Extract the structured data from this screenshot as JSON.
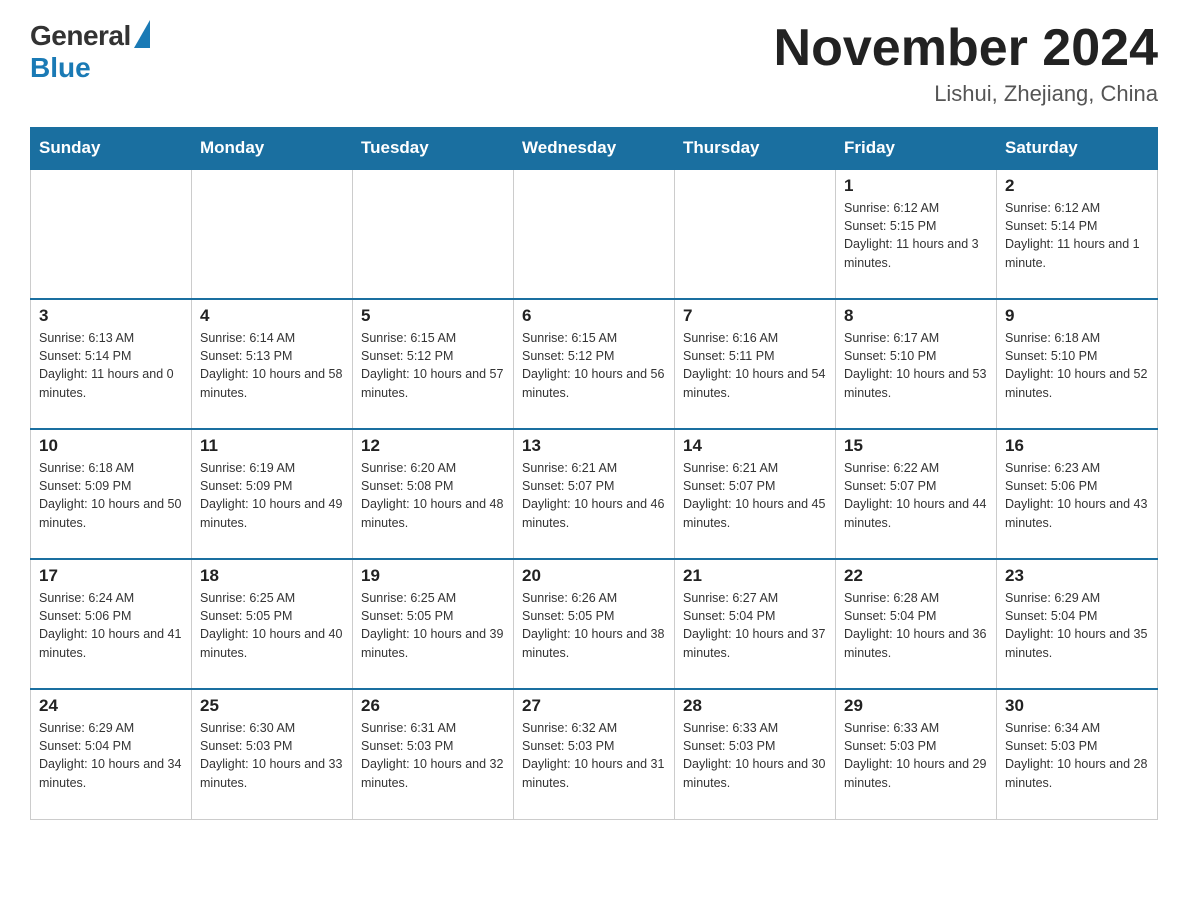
{
  "header": {
    "logo_general": "General",
    "logo_blue": "Blue",
    "month_title": "November 2024",
    "location": "Lishui, Zhejiang, China"
  },
  "days_of_week": [
    "Sunday",
    "Monday",
    "Tuesday",
    "Wednesday",
    "Thursday",
    "Friday",
    "Saturday"
  ],
  "weeks": [
    {
      "days": [
        {
          "number": "",
          "info": ""
        },
        {
          "number": "",
          "info": ""
        },
        {
          "number": "",
          "info": ""
        },
        {
          "number": "",
          "info": ""
        },
        {
          "number": "",
          "info": ""
        },
        {
          "number": "1",
          "info": "Sunrise: 6:12 AM\nSunset: 5:15 PM\nDaylight: 11 hours and 3 minutes."
        },
        {
          "number": "2",
          "info": "Sunrise: 6:12 AM\nSunset: 5:14 PM\nDaylight: 11 hours and 1 minute."
        }
      ]
    },
    {
      "days": [
        {
          "number": "3",
          "info": "Sunrise: 6:13 AM\nSunset: 5:14 PM\nDaylight: 11 hours and 0 minutes."
        },
        {
          "number": "4",
          "info": "Sunrise: 6:14 AM\nSunset: 5:13 PM\nDaylight: 10 hours and 58 minutes."
        },
        {
          "number": "5",
          "info": "Sunrise: 6:15 AM\nSunset: 5:12 PM\nDaylight: 10 hours and 57 minutes."
        },
        {
          "number": "6",
          "info": "Sunrise: 6:15 AM\nSunset: 5:12 PM\nDaylight: 10 hours and 56 minutes."
        },
        {
          "number": "7",
          "info": "Sunrise: 6:16 AM\nSunset: 5:11 PM\nDaylight: 10 hours and 54 minutes."
        },
        {
          "number": "8",
          "info": "Sunrise: 6:17 AM\nSunset: 5:10 PM\nDaylight: 10 hours and 53 minutes."
        },
        {
          "number": "9",
          "info": "Sunrise: 6:18 AM\nSunset: 5:10 PM\nDaylight: 10 hours and 52 minutes."
        }
      ]
    },
    {
      "days": [
        {
          "number": "10",
          "info": "Sunrise: 6:18 AM\nSunset: 5:09 PM\nDaylight: 10 hours and 50 minutes."
        },
        {
          "number": "11",
          "info": "Sunrise: 6:19 AM\nSunset: 5:09 PM\nDaylight: 10 hours and 49 minutes."
        },
        {
          "number": "12",
          "info": "Sunrise: 6:20 AM\nSunset: 5:08 PM\nDaylight: 10 hours and 48 minutes."
        },
        {
          "number": "13",
          "info": "Sunrise: 6:21 AM\nSunset: 5:07 PM\nDaylight: 10 hours and 46 minutes."
        },
        {
          "number": "14",
          "info": "Sunrise: 6:21 AM\nSunset: 5:07 PM\nDaylight: 10 hours and 45 minutes."
        },
        {
          "number": "15",
          "info": "Sunrise: 6:22 AM\nSunset: 5:07 PM\nDaylight: 10 hours and 44 minutes."
        },
        {
          "number": "16",
          "info": "Sunrise: 6:23 AM\nSunset: 5:06 PM\nDaylight: 10 hours and 43 minutes."
        }
      ]
    },
    {
      "days": [
        {
          "number": "17",
          "info": "Sunrise: 6:24 AM\nSunset: 5:06 PM\nDaylight: 10 hours and 41 minutes."
        },
        {
          "number": "18",
          "info": "Sunrise: 6:25 AM\nSunset: 5:05 PM\nDaylight: 10 hours and 40 minutes."
        },
        {
          "number": "19",
          "info": "Sunrise: 6:25 AM\nSunset: 5:05 PM\nDaylight: 10 hours and 39 minutes."
        },
        {
          "number": "20",
          "info": "Sunrise: 6:26 AM\nSunset: 5:05 PM\nDaylight: 10 hours and 38 minutes."
        },
        {
          "number": "21",
          "info": "Sunrise: 6:27 AM\nSunset: 5:04 PM\nDaylight: 10 hours and 37 minutes."
        },
        {
          "number": "22",
          "info": "Sunrise: 6:28 AM\nSunset: 5:04 PM\nDaylight: 10 hours and 36 minutes."
        },
        {
          "number": "23",
          "info": "Sunrise: 6:29 AM\nSunset: 5:04 PM\nDaylight: 10 hours and 35 minutes."
        }
      ]
    },
    {
      "days": [
        {
          "number": "24",
          "info": "Sunrise: 6:29 AM\nSunset: 5:04 PM\nDaylight: 10 hours and 34 minutes."
        },
        {
          "number": "25",
          "info": "Sunrise: 6:30 AM\nSunset: 5:03 PM\nDaylight: 10 hours and 33 minutes."
        },
        {
          "number": "26",
          "info": "Sunrise: 6:31 AM\nSunset: 5:03 PM\nDaylight: 10 hours and 32 minutes."
        },
        {
          "number": "27",
          "info": "Sunrise: 6:32 AM\nSunset: 5:03 PM\nDaylight: 10 hours and 31 minutes."
        },
        {
          "number": "28",
          "info": "Sunrise: 6:33 AM\nSunset: 5:03 PM\nDaylight: 10 hours and 30 minutes."
        },
        {
          "number": "29",
          "info": "Sunrise: 6:33 AM\nSunset: 5:03 PM\nDaylight: 10 hours and 29 minutes."
        },
        {
          "number": "30",
          "info": "Sunrise: 6:34 AM\nSunset: 5:03 PM\nDaylight: 10 hours and 28 minutes."
        }
      ]
    }
  ]
}
